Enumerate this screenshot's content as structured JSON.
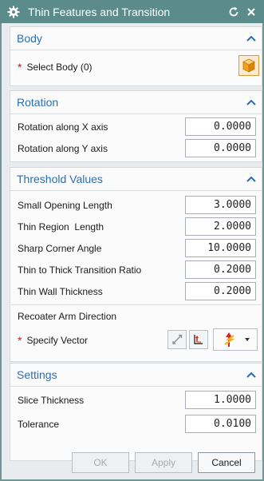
{
  "window": {
    "title": "Thin Features and Transition",
    "icon": "gear-icon"
  },
  "sections": {
    "body": {
      "title": "Body",
      "select_label": "Select Body (0)",
      "required_marker": "*"
    },
    "rotation": {
      "title": "Rotation",
      "fields": [
        {
          "label": "Rotation along X axis",
          "value": "0.0000"
        },
        {
          "label": "Rotation along Y axis",
          "value": "0.0000"
        }
      ]
    },
    "threshold": {
      "title": "Threshold Values",
      "fields": [
        {
          "label": "Small Opening Length",
          "value": "3.0000"
        },
        {
          "label": "Thin Region  Length",
          "value": "2.0000"
        },
        {
          "label": "Sharp Corner Angle",
          "value": "10.0000"
        },
        {
          "label": "Thin to Thick Transition Ratio",
          "value": "0.2000"
        },
        {
          "label": "Thin Wall Thickness",
          "value": "0.2000"
        }
      ],
      "recoater_label": "Recoater Arm Direction",
      "vector_label": "Specify Vector",
      "required_marker": "*"
    },
    "settings": {
      "title": "Settings",
      "fields": [
        {
          "label": "Slice Thickness",
          "value": "1.0000"
        },
        {
          "label": "Tolerance",
          "value": "0.0100"
        }
      ]
    }
  },
  "buttons": {
    "ok": "OK",
    "apply": "Apply",
    "cancel": "Cancel"
  },
  "colors": {
    "title_bar": "#5b8c8b",
    "section_header": "#2b6fb2",
    "required": "#dd1111"
  }
}
